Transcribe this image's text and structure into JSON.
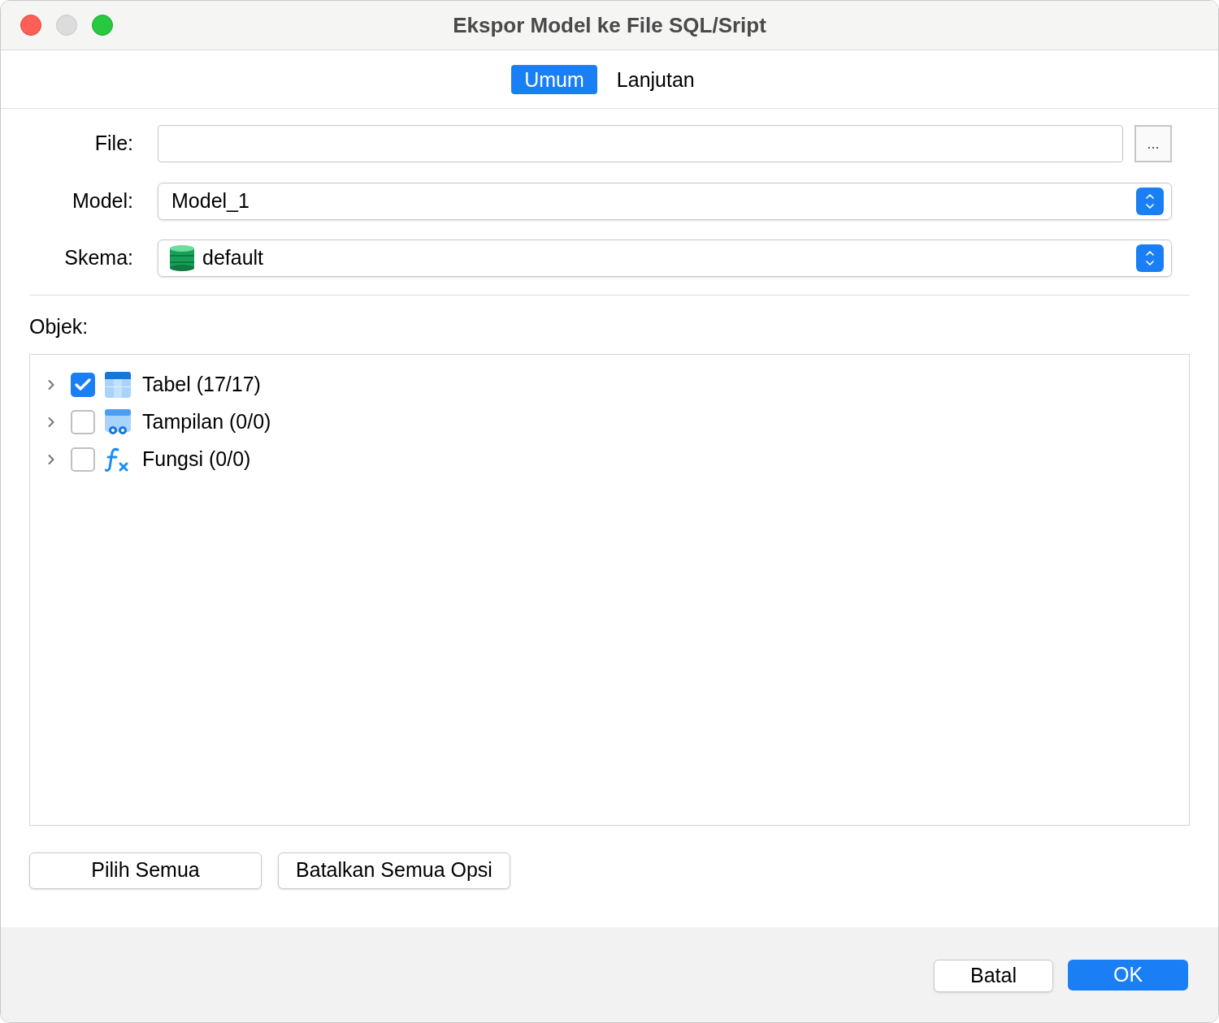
{
  "window": {
    "title": "Ekspor Model ke File SQL/Sript"
  },
  "tabs": [
    {
      "label": "Umum",
      "selected": true
    },
    {
      "label": "Lanjutan",
      "selected": false
    }
  ],
  "form": {
    "file": {
      "label": "File:",
      "browse": "..."
    },
    "model": {
      "label": "Model:",
      "value": "Model_1"
    },
    "schema": {
      "label": "Skema:",
      "value": "default"
    }
  },
  "objects": {
    "label": "Objek:",
    "items": [
      {
        "kind": "table",
        "label": "Tabel (17/17)",
        "checked": true,
        "expanded": false
      },
      {
        "kind": "view",
        "label": "Tampilan (0/0)",
        "checked": false,
        "expanded": false
      },
      {
        "kind": "function",
        "label": "Fungsi (0/0)",
        "checked": false,
        "expanded": false
      }
    ]
  },
  "selection_buttons": [
    "Pilih Semua",
    "Batalkan Semua Opsi"
  ],
  "footer": {
    "cancel": "Batal",
    "ok": "OK"
  }
}
